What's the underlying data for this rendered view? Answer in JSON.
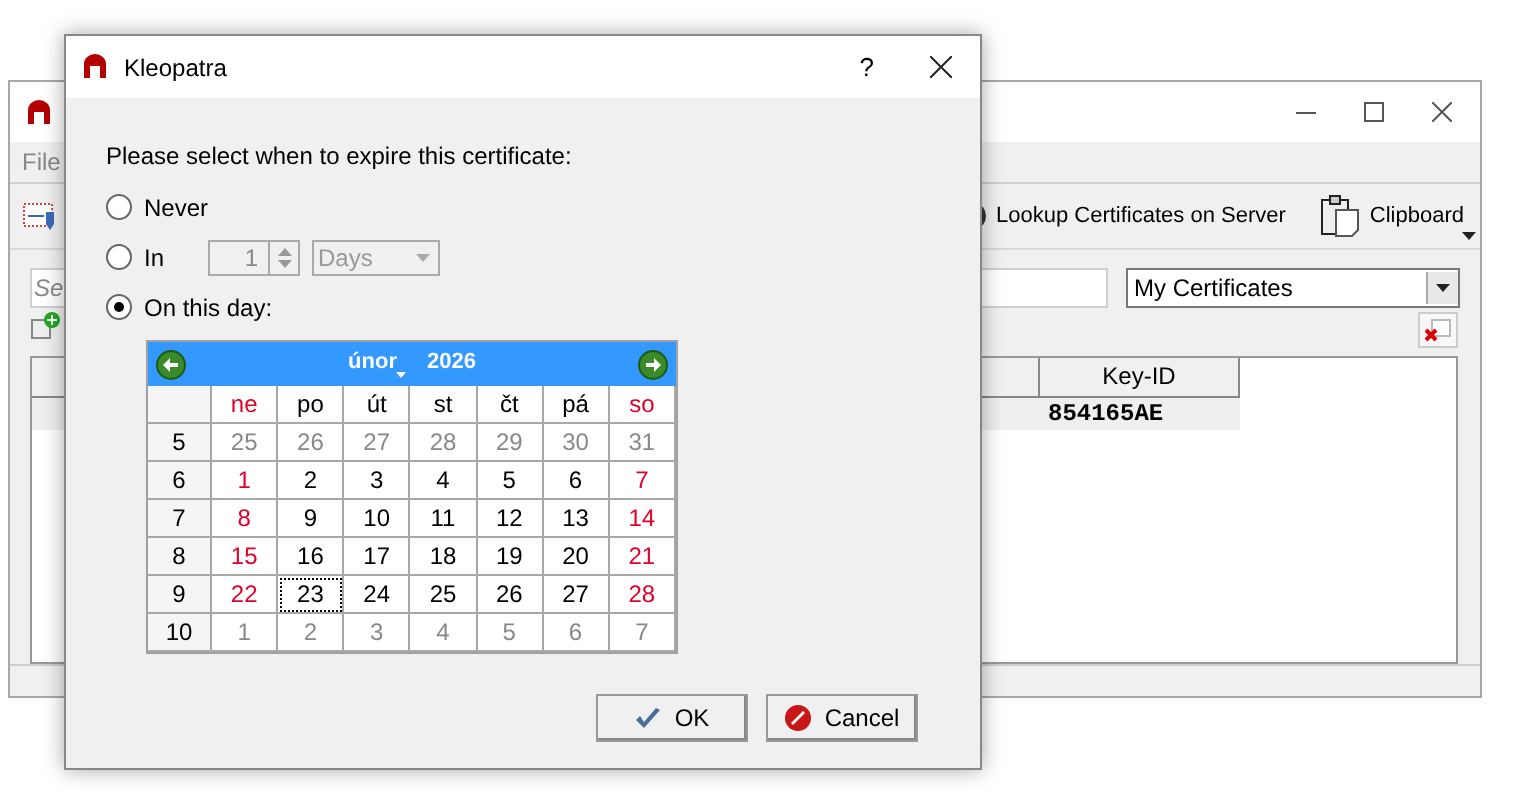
{
  "background_window": {
    "menu": [
      "File"
    ],
    "toolbar": [
      {
        "label": "Lookup Certificates on Server",
        "kind": "lookup"
      },
      {
        "label": "Clipboard",
        "kind": "clipboard"
      }
    ],
    "search": {
      "placeholder": "Se"
    },
    "filter": {
      "value": "My Certificates"
    },
    "table": {
      "columns": [
        "Key-ID"
      ],
      "rows": [
        [
          "854165AE"
        ]
      ]
    }
  },
  "dialog": {
    "title": "Kleopatra",
    "help": "?",
    "prompt": "Please select when to expire this certificate:",
    "options": [
      {
        "label": "Never",
        "kind": "plain",
        "selected": false
      },
      {
        "label": "In",
        "kind": "duration",
        "selected": false,
        "disabled": true,
        "value": "1",
        "unit": "Days"
      },
      {
        "label": "On this day:",
        "kind": "date",
        "selected": true
      }
    ],
    "calendar": {
      "month": "únor",
      "year": "2026",
      "weekdays": [
        {
          "label": "ne",
          "weekend": true
        },
        {
          "label": "po",
          "weekend": false
        },
        {
          "label": "út",
          "weekend": false
        },
        {
          "label": "st",
          "weekend": false
        },
        {
          "label": "čt",
          "weekend": false
        },
        {
          "label": "pá",
          "weekend": false
        },
        {
          "label": "so",
          "weekend": true
        }
      ],
      "weeks": [
        {
          "number": "5",
          "days": [
            {
              "label": "25",
              "other": true,
              "selected": false
            },
            {
              "label": "26",
              "other": true,
              "selected": false
            },
            {
              "label": "27",
              "other": true,
              "selected": false
            },
            {
              "label": "28",
              "other": true,
              "selected": false
            },
            {
              "label": "29",
              "other": true,
              "selected": false
            },
            {
              "label": "30",
              "other": true,
              "selected": false
            },
            {
              "label": "31",
              "other": true,
              "selected": false
            }
          ]
        },
        {
          "number": "6",
          "days": [
            {
              "label": "1",
              "other": false,
              "selected": false
            },
            {
              "label": "2",
              "other": false,
              "selected": false
            },
            {
              "label": "3",
              "other": false,
              "selected": false
            },
            {
              "label": "4",
              "other": false,
              "selected": false
            },
            {
              "label": "5",
              "other": false,
              "selected": false
            },
            {
              "label": "6",
              "other": false,
              "selected": false
            },
            {
              "label": "7",
              "other": false,
              "selected": false
            }
          ]
        },
        {
          "number": "7",
          "days": [
            {
              "label": "8",
              "other": false,
              "selected": false
            },
            {
              "label": "9",
              "other": false,
              "selected": false
            },
            {
              "label": "10",
              "other": false,
              "selected": false
            },
            {
              "label": "11",
              "other": false,
              "selected": false
            },
            {
              "label": "12",
              "other": false,
              "selected": false
            },
            {
              "label": "13",
              "other": false,
              "selected": false
            },
            {
              "label": "14",
              "other": false,
              "selected": false
            }
          ]
        },
        {
          "number": "8",
          "days": [
            {
              "label": "15",
              "other": false,
              "selected": false
            },
            {
              "label": "16",
              "other": false,
              "selected": false
            },
            {
              "label": "17",
              "other": false,
              "selected": false
            },
            {
              "label": "18",
              "other": false,
              "selected": false
            },
            {
              "label": "19",
              "other": false,
              "selected": false
            },
            {
              "label": "20",
              "other": false,
              "selected": false
            },
            {
              "label": "21",
              "other": false,
              "selected": false
            }
          ]
        },
        {
          "number": "9",
          "days": [
            {
              "label": "22",
              "other": false,
              "selected": false
            },
            {
              "label": "23",
              "other": false,
              "selected": true
            },
            {
              "label": "24",
              "other": false,
              "selected": false
            },
            {
              "label": "25",
              "other": false,
              "selected": false
            },
            {
              "label": "26",
              "other": false,
              "selected": false
            },
            {
              "label": "27",
              "other": false,
              "selected": false
            },
            {
              "label": "28",
              "other": false,
              "selected": false
            }
          ]
        },
        {
          "number": "10",
          "days": [
            {
              "label": "1",
              "other": true,
              "selected": false
            },
            {
              "label": "2",
              "other": true,
              "selected": false
            },
            {
              "label": "3",
              "other": true,
              "selected": false
            },
            {
              "label": "4",
              "other": true,
              "selected": false
            },
            {
              "label": "5",
              "other": true,
              "selected": false
            },
            {
              "label": "6",
              "other": true,
              "selected": false
            },
            {
              "label": "7",
              "other": true,
              "selected": false
            }
          ]
        }
      ]
    },
    "buttons": [
      {
        "label": "OK",
        "kind": "ok"
      },
      {
        "label": "Cancel",
        "kind": "cancel"
      }
    ]
  }
}
